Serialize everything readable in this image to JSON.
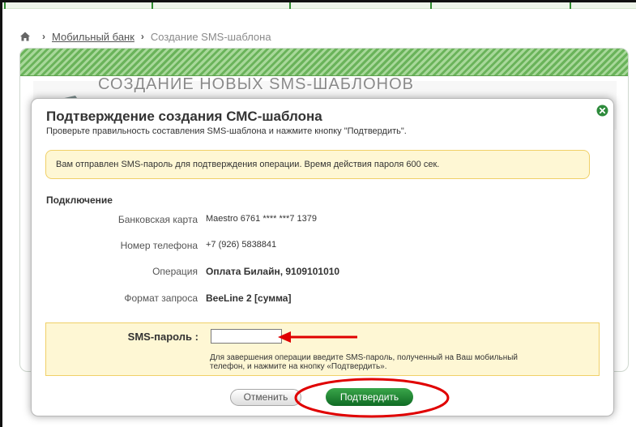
{
  "breadcrumb": {
    "home_icon": "home-icon",
    "link": "Мобильный банк",
    "current": "Создание SMS-шаблона"
  },
  "background": {
    "section_title": "СОЗДАНИЕ НОВЫХ SMS-ШАБЛОНОВ",
    "section_icon": "phone-icon"
  },
  "modal": {
    "title": "Подтверждение создания СМС-шаблона",
    "subtitle": "Проверьте правильность составления SMS-шаблона и нажмите кнопку \"Подтвердить\".",
    "close_icon": "close-icon",
    "notice": "Вам отправлен SMS-пароль для подтверждения операции. Время действия пароля 600 сек.",
    "section_label": "Подключение",
    "details": [
      {
        "label": "Банковская карта",
        "value": "Maestro  6761 **** ***7 1379"
      },
      {
        "label": "Номер телефона",
        "value": "+7 (926) 5838841"
      },
      {
        "label": "Операция",
        "value": "Оплата Билайн, 9109101010"
      },
      {
        "label": "Формат запроса",
        "value": "BeeLine 2 [сумма]"
      }
    ],
    "sms": {
      "label": "SMS-пароль :",
      "value": "",
      "hint": "Для завершения операции введите SMS-пароль, полученный на Ваш мобильный телефон, и нажмите на кнопку «Подтвердить»."
    },
    "buttons": {
      "cancel": "Отменить",
      "confirm": "Подтвердить"
    }
  },
  "colors": {
    "accent_green": "#1f8a34",
    "notice_bg": "#fef7d4",
    "notice_border": "#f0d068",
    "annotation_red": "#e00000"
  }
}
